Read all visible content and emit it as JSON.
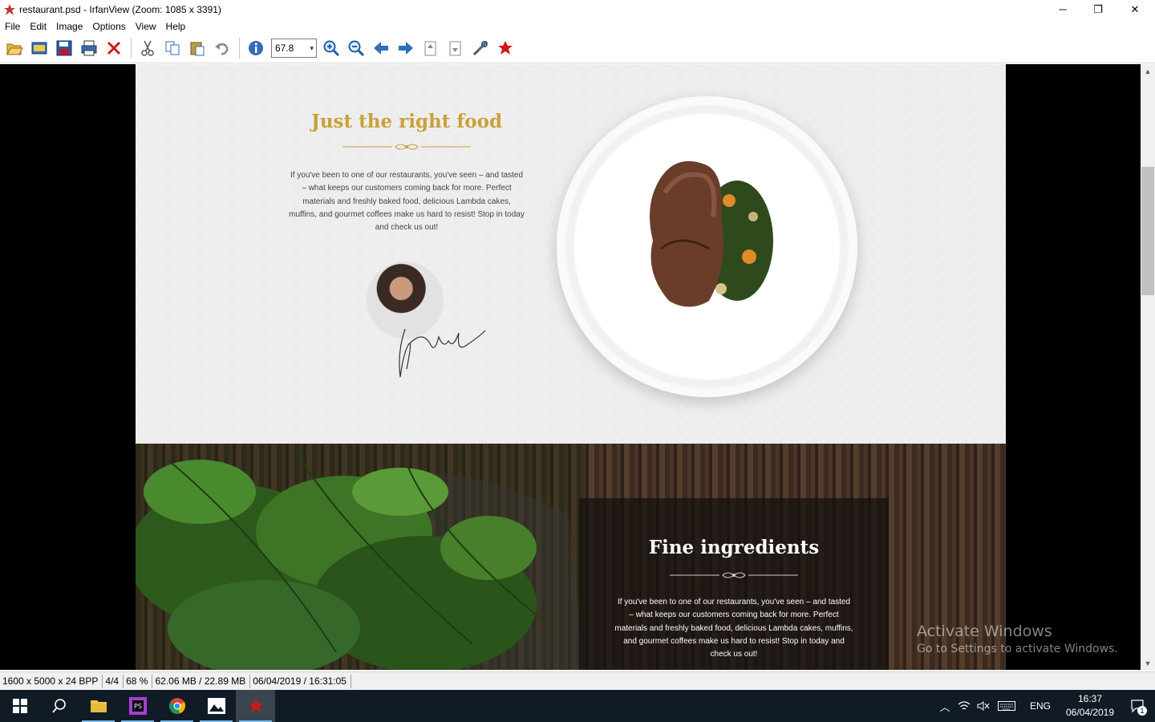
{
  "window": {
    "title": "restaurant.psd - IrfanView (Zoom: 1085 x 3391)",
    "minimize": "─",
    "restore": "❐",
    "close": "✕"
  },
  "menu": [
    "File",
    "Edit",
    "Image",
    "Options",
    "View",
    "Help"
  ],
  "toolbar": {
    "zoom_value": "67.8",
    "icons": [
      "open-icon",
      "thumbnails-icon",
      "save-icon",
      "print-icon",
      "delete-icon",
      "cut-icon",
      "copy-icon",
      "paste-icon",
      "undo-icon",
      "info-icon",
      "zoom-in-icon",
      "zoom-out-icon",
      "previous-icon",
      "next-icon",
      "page-up-icon",
      "page-down-icon",
      "properties-icon",
      "irfanview-icon"
    ]
  },
  "document": {
    "section1": {
      "title": "Just the right food",
      "text": "If you've been to one of our restaurants, you've seen – and tasted – what keeps our customers coming back for more. Perfect materials and freshly baked food, delicious Lambda cakes,  muffins, and gourmet coffees make us hard to resist! Stop in today and check us out!"
    },
    "section2": {
      "title": "Fine ingredients",
      "text": "If you've been to one of our restaurants, you've seen – and tasted – what keeps our customers coming back for more. Perfect materials and freshly baked food, delicious Lambda cakes,  muffins, and gourmet coffees make us hard to resist! Stop in today and check us out!"
    },
    "accent_color": "#c9a13a"
  },
  "watermark": {
    "title": "Activate Windows",
    "subtitle": "Go to Settings to activate Windows."
  },
  "status": {
    "dimensions": "1600 x 5000 x 24 BPP",
    "page": "4/4",
    "zoom": "68 %",
    "memory": "62.06 MB / 22.89 MB",
    "datetime": "06/04/2019 / 16:31:05"
  },
  "taskbar": {
    "lang": "ENG",
    "time": "16:37",
    "date": "06/04/2019",
    "notifications": "1"
  }
}
